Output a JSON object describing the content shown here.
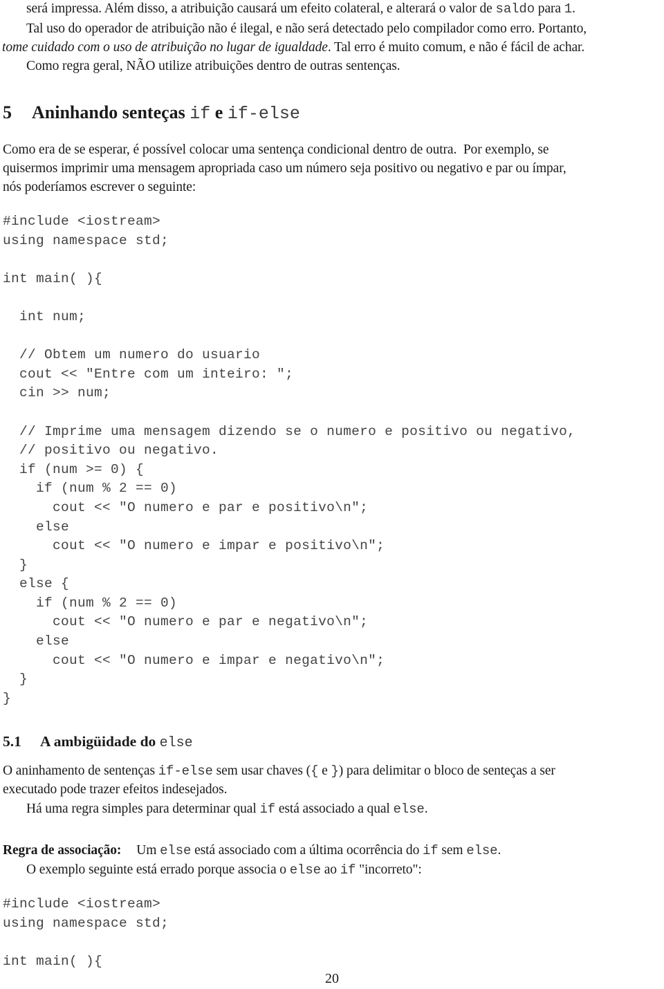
{
  "intro": {
    "line1_pre": "será impressa. Além disso, a atribuição causará um efeito colateral, e alterará o valor de ",
    "line1_code1": "saldo",
    "line1_mid": " para ",
    "line1_code2": "1",
    "line1_post": ".",
    "line2": "Tal uso do operador de atribuição não é ilegal, e não será detectado pelo compilador como erro. Portanto,",
    "line3_italic": "tome cuidado com o uso de atribuição no lugar de igualdade",
    "line3_post": ". Tal erro é muito comum, e não é fácil de achar.",
    "line4": "Como regra geral, NÃO utilize atribuições dentro de outras sentenças."
  },
  "section5": {
    "number": "5",
    "title_pre": "Aninhando senteças ",
    "title_code1": "if",
    "title_mid": " e ",
    "title_code2": "if-else",
    "para_lines": [
      "Como era de se esperar, é possível colocar uma sentença condicional dentro de outra.  Por exemplo, se",
      "quisermos imprimir uma mensagem apropriada caso um número seja positivo ou negativo e par ou ímpar,",
      "nós poderíamos escrever o seguinte:"
    ]
  },
  "code1": {
    "lines": [
      "#include <iostream>",
      "using namespace std;",
      "",
      "int main( ){",
      "",
      "  int num;",
      "",
      "  // Obtem um numero do usuario",
      "  cout << \"Entre com um inteiro: \";",
      "  cin >> num;",
      "",
      "  // Imprime uma mensagem dizendo se o numero e positivo ou negativo,",
      "  // positivo ou negativo.",
      "  if (num >= 0) {",
      "    if (num % 2 == 0)",
      "      cout << \"O numero e par e positivo\\n\";",
      "    else",
      "      cout << \"O numero e impar e positivo\\n\";",
      "  }",
      "  else {",
      "    if (num % 2 == 0)",
      "      cout << \"O numero e par e negativo\\n\";",
      "    else",
      "      cout << \"O numero e impar e negativo\\n\";",
      "  }",
      "}"
    ]
  },
  "section5_1": {
    "number": "5.1",
    "title_pre": "A ambigüidade do ",
    "title_code": "else",
    "p1_pre": "O aninhamento de sentenças ",
    "p1_code1": "if-else",
    "p1_mid1": " sem usar chaves (",
    "p1_code2": "{",
    "p1_mid2": " e ",
    "p1_code3": "}",
    "p1_post": ") para delimitar o bloco de senteças a ser",
    "p1_line2": "executado pode trazer efeitos indesejados.",
    "p2_pre": "Há uma regra simples para determinar qual ",
    "p2_code1": "if",
    "p2_mid": " está associado a qual ",
    "p2_code2": "else",
    "p2_post": ".",
    "rule_label": "Regra de associação:",
    "rule_pre": "Um ",
    "rule_code1": "else",
    "rule_mid1": " está associado com a última ocorrência do ",
    "rule_code2": "if",
    "rule_mid2": " sem ",
    "rule_code3": "else",
    "rule_post": ".",
    "p3_pre": "O exemplo seguinte está errado porque associa o ",
    "p3_code1": "else",
    "p3_mid": " ao ",
    "p3_code2": "if",
    "p3_post": " \"incorreto\":"
  },
  "code2": {
    "lines": [
      "#include <iostream>",
      "using namespace std;",
      "",
      "int main( ){"
    ]
  },
  "footer": {
    "page_number": "20"
  }
}
